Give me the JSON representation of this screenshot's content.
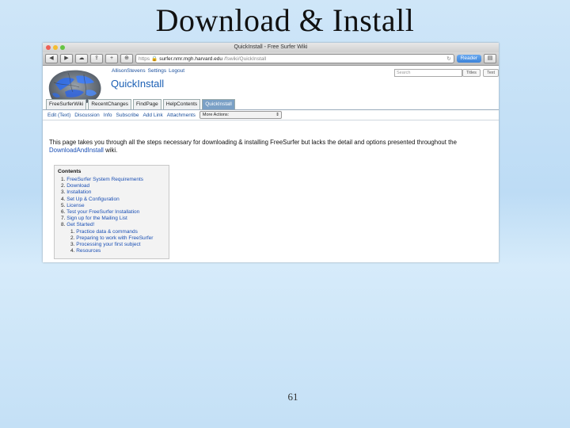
{
  "slide": {
    "title": "Download & Install",
    "page_number": "61"
  },
  "browser": {
    "window_title": "QuickInstall - Free Surfer Wiki",
    "url_scheme": "https",
    "url_host": "surfer.nmr.mgh.harvard.edu",
    "url_path": "/fswiki/QuickInstall",
    "reader_label": "Reader"
  },
  "wiki": {
    "user_links": [
      "AllisonStevens",
      "Settings",
      "Logout"
    ],
    "page_title": "QuickInstall",
    "search_placeholder": "Search",
    "titles_button": "Titles",
    "text_button": "Text",
    "tabs": [
      "FreeSurferWiki",
      "RecentChanges",
      "FindPage",
      "HelpContents",
      "QuickInstall"
    ],
    "actions": [
      "Edit (Text)",
      "Discussion",
      "Info",
      "Subscribe",
      "Add Link",
      "Attachments"
    ],
    "more_actions": "More Actions:",
    "intro_text": "This page takes you through all the steps necessary for downloading & installing FreeSurfer but lacks the detail and options presented throughout the ",
    "intro_link": "DownloadAndInstall",
    "intro_suffix": " wiki.",
    "contents_title": "Contents",
    "contents": [
      {
        "num": "1.",
        "label": "FreeSurfer System Requirements"
      },
      {
        "num": "2.",
        "label": "Download"
      },
      {
        "num": "3.",
        "label": "Installation"
      },
      {
        "num": "4.",
        "label": "Set Up & Configuration"
      },
      {
        "num": "5.",
        "label": "License"
      },
      {
        "num": "6.",
        "label": "Test your FreeSurfer Installation"
      },
      {
        "num": "7.",
        "label": "Sign up for the Mailing List"
      },
      {
        "num": "8.",
        "label": "Get Started!"
      }
    ],
    "subcontents": [
      {
        "num": "1.",
        "label": "Practice data & commands"
      },
      {
        "num": "2.",
        "label": "Preparing to work with FreeSurfer"
      },
      {
        "num": "3.",
        "label": "Processing your first subject"
      },
      {
        "num": "4.",
        "label": "Resources"
      }
    ]
  }
}
